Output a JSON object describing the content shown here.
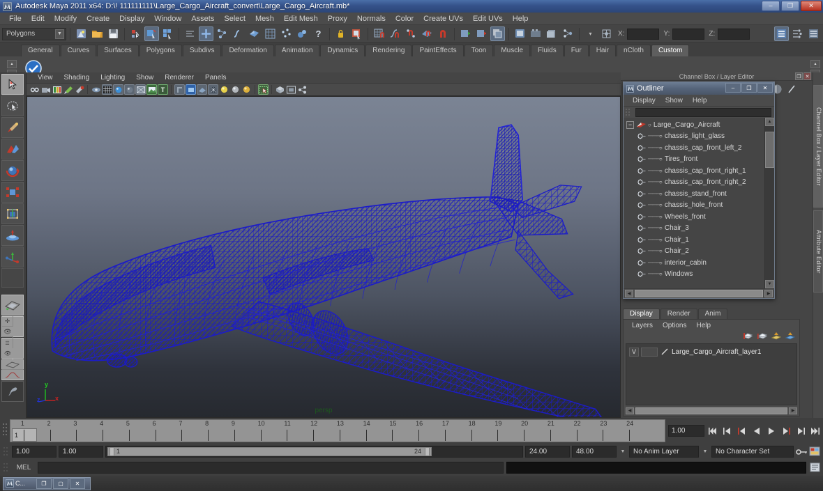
{
  "window": {
    "title": "Autodesk Maya 2011 x64: D:\\! 111111111\\Large_Cargo_Aircraft_convert\\Large_Cargo_Aircraft.mb*",
    "app_icon": "maya-icon",
    "minimize": "–",
    "maximize": "❐",
    "close": "✕"
  },
  "menubar": {
    "items": [
      {
        "label": "File"
      },
      {
        "label": "Edit"
      },
      {
        "label": "Modify"
      },
      {
        "label": "Create"
      },
      {
        "label": "Display"
      },
      {
        "label": "Window"
      },
      {
        "label": "Assets"
      },
      {
        "label": "Select"
      },
      {
        "label": "Mesh"
      },
      {
        "label": "Edit Mesh"
      },
      {
        "label": "Proxy"
      },
      {
        "label": "Normals"
      },
      {
        "label": "Color"
      },
      {
        "label": "Create UVs"
      },
      {
        "label": "Edit UVs"
      },
      {
        "label": "Help"
      }
    ]
  },
  "statusbar": {
    "menu_set": "Polygons",
    "menu_set_arrow": "▼",
    "x_label": "X:",
    "y_label": "Y:",
    "z_label": "Z:",
    "x_value": "",
    "y_value": "",
    "z_value": ""
  },
  "shelf": {
    "tabs": [
      {
        "label": "General"
      },
      {
        "label": "Curves"
      },
      {
        "label": "Surfaces"
      },
      {
        "label": "Polygons"
      },
      {
        "label": "Subdivs"
      },
      {
        "label": "Deformation"
      },
      {
        "label": "Animation"
      },
      {
        "label": "Dynamics"
      },
      {
        "label": "Rendering"
      },
      {
        "label": "PaintEffects"
      },
      {
        "label": "Toon"
      },
      {
        "label": "Muscle"
      },
      {
        "label": "Fluids"
      },
      {
        "label": "Fur"
      },
      {
        "label": "Hair"
      },
      {
        "label": "nCloth"
      },
      {
        "label": "Custom"
      }
    ],
    "active_tab": "Custom"
  },
  "toolbox": {
    "tools": [
      {
        "name": "select-tool",
        "active": true
      },
      {
        "name": "lasso-select-tool",
        "active": false
      },
      {
        "name": "paint-select-tool",
        "active": false
      },
      {
        "name": "move-tool",
        "active": false
      },
      {
        "name": "rotate-tool",
        "active": false
      },
      {
        "name": "scale-tool",
        "active": false
      },
      {
        "name": "universal-manipulator-tool",
        "active": false
      },
      {
        "name": "soft-modification-tool",
        "active": false
      },
      {
        "name": "show-manipulator-tool",
        "active": false
      },
      {
        "name": "last-tool-used",
        "active": false
      }
    ]
  },
  "viewport": {
    "menu": [
      {
        "label": "View"
      },
      {
        "label": "Shading"
      },
      {
        "label": "Lighting"
      },
      {
        "label": "Show"
      },
      {
        "label": "Renderer"
      },
      {
        "label": "Panels"
      }
    ],
    "camera_label": "persp",
    "axis_x": "x",
    "axis_y": "y",
    "axis_z": "z",
    "model_name": "Large_Cargo_Aircraft",
    "wireframe_color": "#1a1ab4",
    "background_top": "#7b8494",
    "background_bottom": "#26292f"
  },
  "right_dock": {
    "header_label": "Channel Box / Layer Editor",
    "header_restore": "❐",
    "header_close": "✕",
    "side_tabs": [
      {
        "label": "Channel Box / Layer Editor",
        "active": true
      },
      {
        "label": "Attribute Editor",
        "active": false
      }
    ]
  },
  "outliner": {
    "title": "Outliner",
    "window_icon": "outliner-icon",
    "minimize": "–",
    "maximize": "❐",
    "close": "✕",
    "menu": [
      {
        "label": "Display"
      },
      {
        "label": "Show"
      },
      {
        "label": "Help"
      }
    ],
    "search_value": "",
    "root": {
      "label": "Large_Cargo_Aircraft",
      "expanded": true,
      "expand_glyph": "−"
    },
    "children": [
      {
        "label": "chassis_light_glass"
      },
      {
        "label": "chassis_cap_front_left_2"
      },
      {
        "label": "Tires_front"
      },
      {
        "label": "chassis_cap_front_right_1"
      },
      {
        "label": "chassis_cap_front_right_2"
      },
      {
        "label": "chassis_stand_front"
      },
      {
        "label": "chassis_hole_front"
      },
      {
        "label": "Wheels_front"
      },
      {
        "label": "Chair_3"
      },
      {
        "label": "Chair_1"
      },
      {
        "label": "Chair_2"
      },
      {
        "label": "interior_cabin"
      },
      {
        "label": "Windows"
      }
    ],
    "scroll_up": "▲",
    "scroll_down": "▼",
    "scroll_left": "◀",
    "scroll_right": "▶"
  },
  "layer_editor": {
    "tabs": [
      {
        "label": "Display",
        "active": true
      },
      {
        "label": "Render",
        "active": false
      },
      {
        "label": "Anim",
        "active": false
      }
    ],
    "menu": [
      {
        "label": "Layers"
      },
      {
        "label": "Options"
      },
      {
        "label": "Help"
      }
    ],
    "tool_icons": [
      "new-layer-from-selected-icon",
      "new-empty-layer-icon",
      "layer-up-icon",
      "layer-down-icon"
    ],
    "layers": [
      {
        "visibility": "V",
        "display_type": "",
        "name": "Large_Cargo_Aircraft_layer1"
      }
    ],
    "scroll_left": "◀",
    "scroll_right": "▶"
  },
  "timeline": {
    "ticks": [
      "1",
      "2",
      "3",
      "4",
      "5",
      "6",
      "7",
      "8",
      "9",
      "10",
      "11",
      "12",
      "13",
      "14",
      "15",
      "16",
      "17",
      "18",
      "19",
      "20",
      "21",
      "22",
      "23",
      "24"
    ],
    "current_frame": "1",
    "current_time_field": "1.00",
    "playback_buttons": [
      "go-to-start",
      "step-back-key",
      "step-back-frame",
      "play-backwards",
      "play-forwards",
      "step-forward-frame",
      "step-forward-key",
      "go-to-end"
    ]
  },
  "range_slider": {
    "anim_start": "1.00",
    "anim_end": "1.00",
    "range_start_label": "1",
    "range_end_label": "24",
    "playback_start": "24.00",
    "playback_end": "48.00",
    "anim_layer": "No Anim Layer",
    "character_set": "No Character Set",
    "dropdown_arrow": "▼"
  },
  "command_line": {
    "language_label": "MEL",
    "input_value": "",
    "output_value": ""
  },
  "taskbar": {
    "items": [
      {
        "label": "C...",
        "icon": "maya-icon",
        "restore": "❐",
        "maximize": "▢",
        "close": "✕"
      }
    ]
  }
}
